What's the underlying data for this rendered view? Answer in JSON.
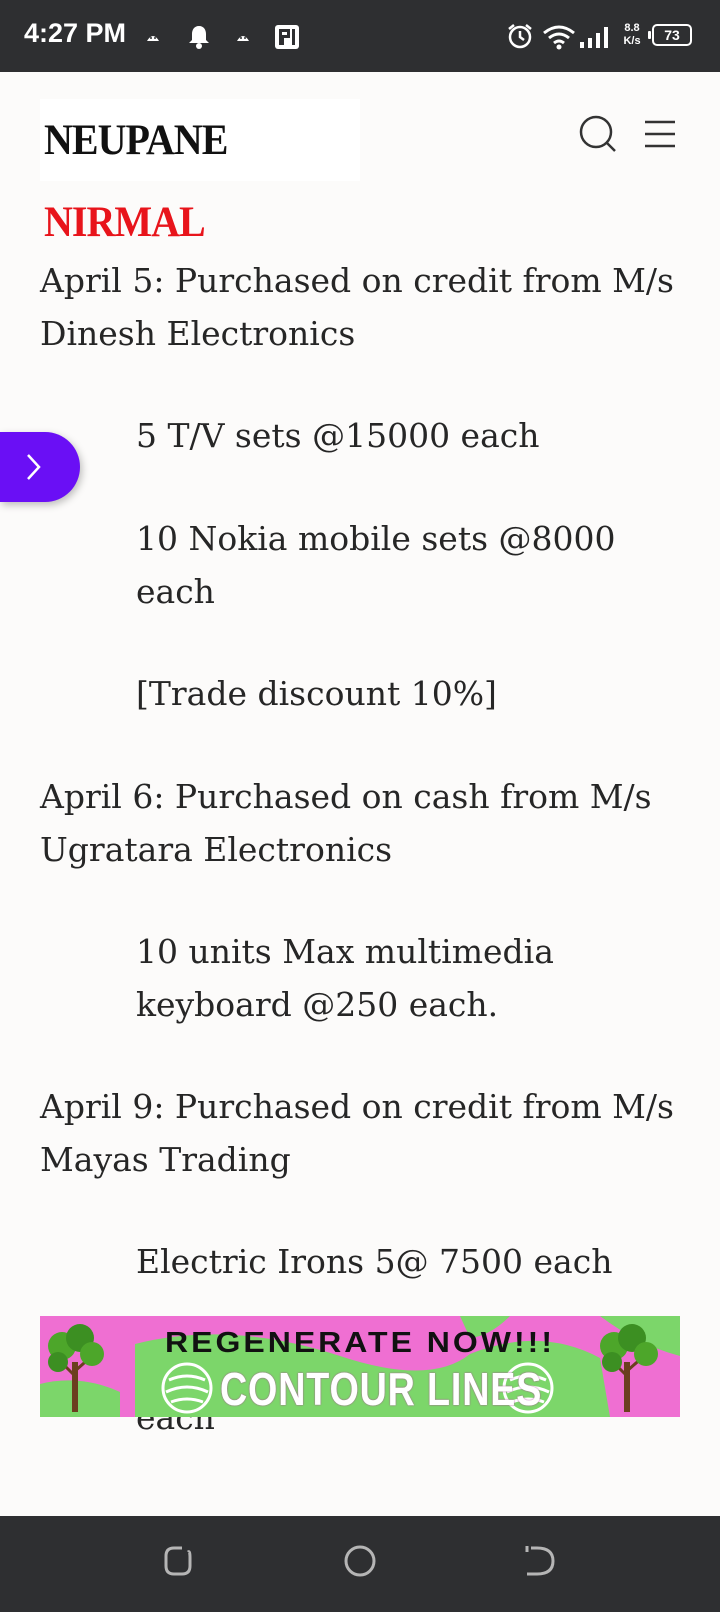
{
  "status_bar": {
    "time": "4:27 PM",
    "net_speed_value": "8.8",
    "net_speed_unit": "K/s",
    "battery": "73",
    "icons": [
      "android-icon",
      "bell-icon",
      "android-icon",
      "pi-icon",
      "alarm-icon",
      "wifi-icon",
      "signal-icon",
      "battery-icon"
    ]
  },
  "header": {
    "logo_part1": "NEUPANE",
    "logo_part2": "NIRMAL",
    "logo_colors": {
      "part1": "#111111",
      "part2": "#e8141b"
    },
    "icons": [
      "search-icon",
      "hamburger-menu-icon"
    ]
  },
  "content": {
    "paragraphs": [
      {
        "text": "April 5: Purchased on credit from M/s Dinesh Electronics",
        "indent": false
      },
      {
        "text": "5 T/V sets @15000 each",
        "indent": true
      },
      {
        "text": "10 Nokia mobile sets @8000 each",
        "indent": true
      },
      {
        "text": "[Trade discount 10%]",
        "indent": true
      },
      {
        "text": "April 6: Purchased on cash from M/s Ugratara Electronics",
        "indent": false
      },
      {
        "text": "10 units Max multimedia keyboard @250 each.",
        "indent": true
      },
      {
        "text": "April 9: Purchased on credit from M/s Mayas Trading",
        "indent": false
      },
      {
        "text": "Electric Irons 5@ 7500 each",
        "indent": true
      },
      {
        "text": "each",
        "indent": true
      }
    ]
  },
  "side_tab": {
    "icon": "chevron-right-icon",
    "color": "#6a0ff5"
  },
  "banner": {
    "line1": "REGENERATE NOW!!!",
    "line2": "CONTOUR LINES",
    "colors": {
      "pink": "#ef6fd2",
      "green": "#7cd66a"
    }
  },
  "nav_bar": {
    "buttons": [
      "recent-apps-icon",
      "home-icon",
      "back-icon"
    ]
  }
}
